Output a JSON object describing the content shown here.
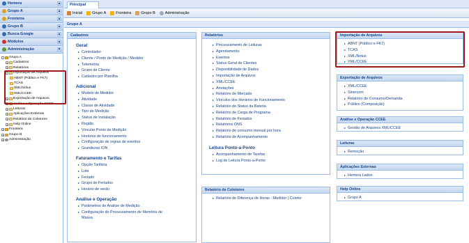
{
  "sidebar": {
    "sections": [
      {
        "label": "Hemera",
        "color": "#2d6fb7"
      },
      {
        "label": "Grupo A",
        "color": "#e0a020"
      },
      {
        "label": "Fronteira",
        "color": "#e0a020"
      },
      {
        "label": "Grupo B",
        "color": "#2d6fb7"
      },
      {
        "label": "Busca Google",
        "color": "#2d6fb7"
      },
      {
        "label": "Módulos",
        "color": "#d03030"
      },
      {
        "label": "Administração",
        "color": "#5a9a30"
      }
    ],
    "tree": [
      {
        "label": "Grupo A",
        "level": 0,
        "exp": "-",
        "icon": "bolt"
      },
      {
        "label": "Cadastros",
        "level": 1,
        "exp": "+",
        "icon": "folder"
      },
      {
        "label": "Relatórios",
        "level": 1,
        "exp": "+",
        "icon": "folder"
      },
      {
        "label": "Importação de Arquivos",
        "level": 1,
        "exp": "-",
        "icon": "folder"
      },
      {
        "label": "ABNT (Público e FK7)",
        "level": 2,
        "exp": "",
        "icon": "folder"
      },
      {
        "label": "TCAS",
        "level": 2,
        "exp": "",
        "icon": "folder"
      },
      {
        "label": "XML/Notus",
        "level": 2,
        "exp": "",
        "icon": "folder"
      },
      {
        "label": "XML/CCEE",
        "level": 2,
        "exp": "",
        "icon": "folder"
      },
      {
        "label": "Exportação de Arquivos",
        "level": 1,
        "exp": "+",
        "icon": "folder"
      },
      {
        "label": "Análise e Operação CCEE",
        "level": 1,
        "exp": "+",
        "icon": "folder"
      },
      {
        "label": "Leituras",
        "level": 1,
        "exp": "+",
        "icon": "folder"
      },
      {
        "label": "Aplicações Externas",
        "level": 1,
        "exp": "+",
        "icon": "folder"
      },
      {
        "label": "Relatório de Coletores",
        "level": 1,
        "exp": "+",
        "icon": "folder"
      },
      {
        "label": "Help Online",
        "level": 1,
        "exp": "+",
        "icon": "folder"
      },
      {
        "label": "Fronteira",
        "level": 0,
        "exp": "+",
        "icon": "bolt"
      },
      {
        "label": "Grupo B",
        "level": 0,
        "exp": "+",
        "icon": "house"
      },
      {
        "label": "Administração",
        "level": 0,
        "exp": "+",
        "icon": "gear"
      }
    ]
  },
  "main": {
    "tab": "Principal",
    "toolbar": [
      "Inicial",
      "Grupo A",
      "Fronteira",
      "Grupo B",
      "Administração"
    ],
    "breadcrumb": "Grupo A",
    "cadastros": {
      "title": "Cadastros",
      "groups": [
        {
          "title": "Geral",
          "items": [
            "Controlador",
            "Cliente / Ponto de Medição / Medidor",
            "Telemetria",
            "Grupo de Cliente",
            "Cadastro por Planilha"
          ]
        },
        {
          "title": "Adicional",
          "items": [
            "Modelo de Medidor",
            "Atividade",
            "Classe de Atividade",
            "Tipo de Medição",
            "Status de Instalação",
            "Região",
            "Vincular Ponto de Medição",
            "Horários de funcionamento",
            "Configuração de regras de eventos",
            "Grandezas ION"
          ]
        },
        {
          "title": "Faturamento e Tarifas",
          "items": [
            "Opção Tarifária",
            "Lote",
            "Feriado",
            "Grupo de Feriados",
            "Horário de verão"
          ]
        },
        {
          "title": "Análise e Operação",
          "items": [
            "Parâmetros de Análise de Medição",
            "Configuração do Processamento de Memória de"
          ]
        }
      ],
      "overflow": "Massa"
    },
    "relatorios": {
      "title": "Relatórios",
      "items": [
        "Processamento de Leituras",
        "Agendamento",
        "Eventos",
        "Status Geral de Clientes",
        "Disponibilidade de Dados",
        "Importação de Arquivos",
        "XML/CCEE",
        "Anotações",
        "Relatório de Mercado",
        "Vínculos dos Horários de Funcionamento",
        "Relatório de Status da Bateria",
        "Relatório de Carga de Programa",
        "Relatório de Feriados",
        "Relatórios ONS",
        "Relatório de consumo mensal por hora",
        "Relatório de Acompanhamento"
      ],
      "sub_title": "Leitura Ponto-a-Ponto",
      "sub_items": [
        "Acompanhamento de Tarefas",
        "Log de Leitura Ponto-a-Ponto"
      ]
    },
    "coletores": {
      "title": "Relatório de Coletores",
      "items": [
        "Relatório de Diferença de Horas - Medidor | Coletor"
      ]
    },
    "importacao": {
      "title": "Importação de Arquivos",
      "items": [
        "ABNT (Público e FK7)",
        "TCAS",
        "XML/Notus",
        "XML/CCEE"
      ]
    },
    "exportacao": {
      "title": "Exportação de Arquivos",
      "items": [
        "XML/CCEE",
        "Sinercom",
        "Relatório de Consumo/Demanda",
        "Público (Composição)"
      ]
    },
    "analise": {
      "title": "Análise e Operação CCEE",
      "items": [
        "Gestão de Arquivos XML/CCEE"
      ]
    },
    "leituras": {
      "title": "Leituras",
      "items": [
        "Remoção"
      ]
    },
    "externas": {
      "title": "Aplicações Externas",
      "items": [
        "Hemera Ladon"
      ]
    },
    "help": {
      "title": "Help Online",
      "items": [
        "Grupo A"
      ]
    }
  },
  "colors": {
    "highlight": "#a01818",
    "link": "#15428b",
    "panel_border": "#99bbe8"
  }
}
